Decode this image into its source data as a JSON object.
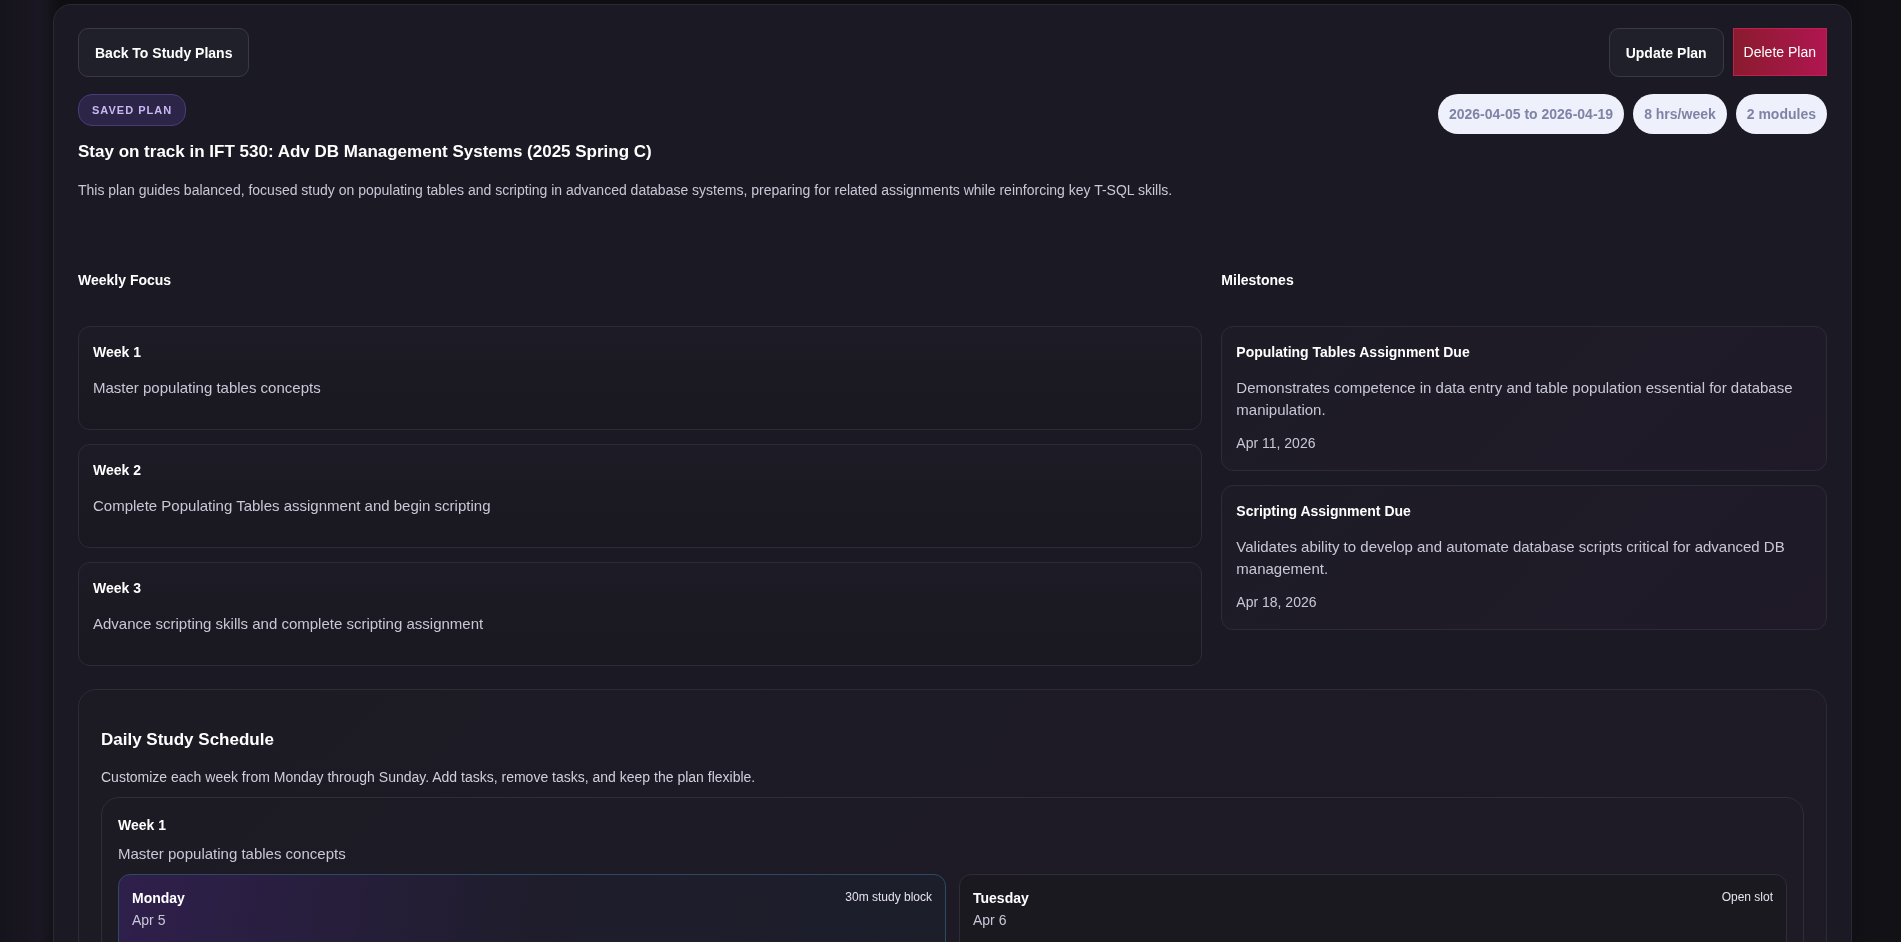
{
  "actions": {
    "back": "Back To Study Plans",
    "update": "Update Plan",
    "delete": "Delete Plan"
  },
  "badge": "SAVED PLAN",
  "title": "Stay on track in IFT 530: Adv DB Management Systems (2025 Spring C)",
  "description": "This plan guides balanced, focused study on populating tables and scripting in advanced database systems, preparing for related assignments while reinforcing key T-SQL skills.",
  "chips": [
    "2026-04-05 to 2026-04-19",
    "8 hrs/week",
    "2 modules"
  ],
  "weekly_focus": {
    "heading": "Weekly Focus",
    "weeks": [
      {
        "title": "Week 1",
        "text": "Master populating tables concepts"
      },
      {
        "title": "Week 2",
        "text": "Complete Populating Tables assignment and begin scripting"
      },
      {
        "title": "Week 3",
        "text": "Advance scripting skills and complete scripting assignment"
      }
    ]
  },
  "milestones": {
    "heading": "Milestones",
    "items": [
      {
        "title": "Populating Tables Assignment Due",
        "text": "Demonstrates competence in data entry and table population essential for database manipulation.",
        "date": "Apr 11, 2026"
      },
      {
        "title": "Scripting Assignment Due",
        "text": "Validates ability to develop and automate database scripts critical for advanced DB management.",
        "date": "Apr 18, 2026"
      }
    ]
  },
  "schedule": {
    "title": "Daily Study Schedule",
    "subtitle": "Customize each week from Monday through Sunday. Add tasks, remove tasks, and keep the plan flexible.",
    "week": {
      "title": "Week 1",
      "text": "Master populating tables concepts",
      "days": [
        {
          "day": "Monday",
          "date": "Apr 5",
          "tag": "30m study block",
          "active": true
        },
        {
          "day": "Tuesday",
          "date": "Apr 6",
          "tag": "Open slot",
          "active": false
        }
      ]
    }
  }
}
